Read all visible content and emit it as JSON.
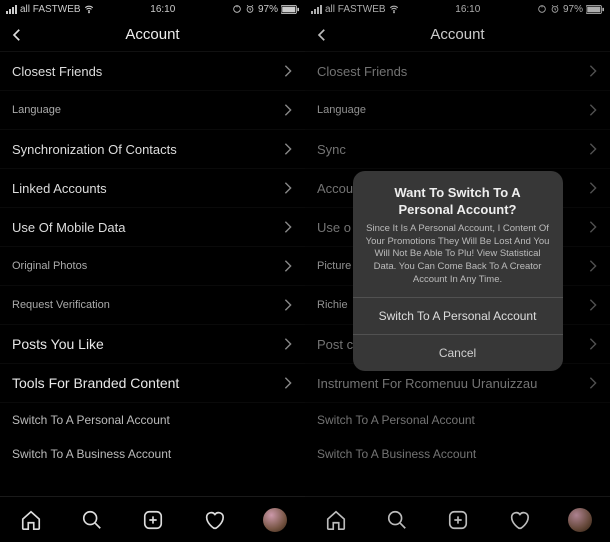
{
  "status": {
    "carrier": "all FASTWEB",
    "time": "16:10",
    "battery": "97%"
  },
  "header": {
    "title": "Account"
  },
  "items": {
    "closest_friends": "Closest Friends",
    "language": "Language",
    "sync": "Synchronization Of Contacts",
    "linked": "Linked Accounts",
    "mobile_data": "Use Of Mobile Data",
    "original_photos": "Original Photos",
    "request_verif": "Request Verification",
    "posts_like": "Posts You Like",
    "tools_branded": "Tools For Branded Content",
    "switch_personal": "Switch To A Personal Account",
    "switch_business": "Switch To A Business Account"
  },
  "items_right": {
    "sync": "Sync",
    "accounts": "Accou",
    "use": "Use o",
    "picture": "Picture",
    "richie": "Richie",
    "post": "Post c",
    "instrument": "Instrument For Rcomenuu Uranuizzau",
    "switch_personal": "Switch To A Personal Account",
    "switch_business": "Switch To A Business Account"
  },
  "dialog": {
    "title": "Want To Switch To A Personal Account?",
    "body": "Since It Is A Personal Account, I Content Of Your Promotions They Will Be Lost And You Will Not Be Able To Plu! View Statistical Data. You Can Come Back To A Creator Account In Any Time.",
    "confirm": "Switch To A Personal Account",
    "cancel": "Cancel"
  }
}
